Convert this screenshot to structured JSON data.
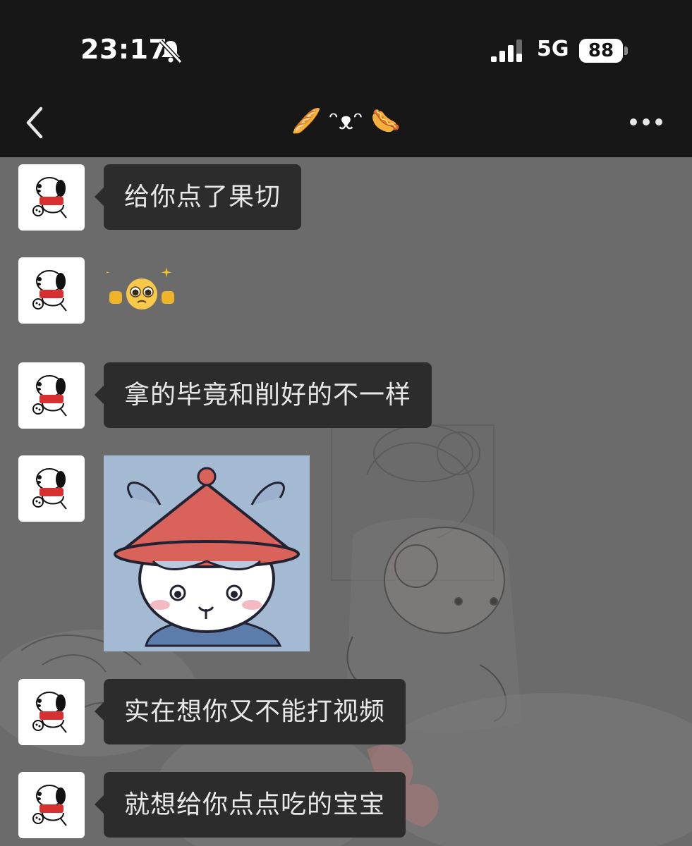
{
  "status_bar": {
    "time": "23:17",
    "network": "5G",
    "battery": "88"
  },
  "nav": {
    "title": "🥖 ᵔᴥᵔ 🌭"
  },
  "messages": [
    {
      "type": "text",
      "text": "给你点了果切"
    },
    {
      "type": "emoji",
      "emoji": "✊🥺✊"
    },
    {
      "type": "text",
      "text": "拿的毕竟和削好的不一样"
    },
    {
      "type": "sticker",
      "sticker": "white-cat-red-hat-sticker"
    },
    {
      "type": "text",
      "text": "实在想你又不能打视频"
    },
    {
      "type": "text",
      "text": "就想给你点点吃的宝宝"
    }
  ],
  "icons": {
    "back": "back-chevron-icon",
    "more": "more-dots-icon",
    "mute": "bell-mute-icon",
    "signal": "signal-bars-icon",
    "avatar": "snoopy-avatar"
  },
  "colors": {
    "bar_bg": "#171717",
    "chat_bg": "#6b6b6b",
    "bubble_bg": "#2c2c2c",
    "bubble_text": "#e8e8e8"
  }
}
